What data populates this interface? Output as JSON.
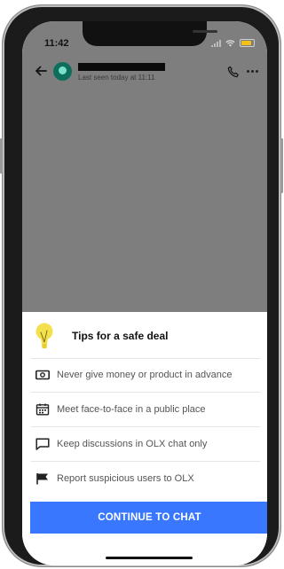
{
  "status_bar": {
    "time": "11:42"
  },
  "chat_header": {
    "last_seen": "Last seen today at 11:11",
    "icons": [
      "back-arrow-icon",
      "avatar",
      "phone-icon",
      "more-icon"
    ]
  },
  "safety_sheet": {
    "title": "Tips for a safe deal",
    "tips": [
      {
        "icon": "money-icon",
        "text": "Never give money or product in advance"
      },
      {
        "icon": "calendar-icon",
        "text": "Meet face-to-face in a public place"
      },
      {
        "icon": "chat-bubble-icon",
        "text": "Keep discussions in OLX chat only"
      },
      {
        "icon": "flag-icon",
        "text": "Report suspicious users to OLX"
      }
    ],
    "continue_label": "CONTINUE TO CHAT"
  },
  "colors": {
    "accent": "#3a77ff",
    "overlay": "#7e7e7e",
    "bulb": "#f4e04d",
    "battery": "#f2c21b"
  }
}
